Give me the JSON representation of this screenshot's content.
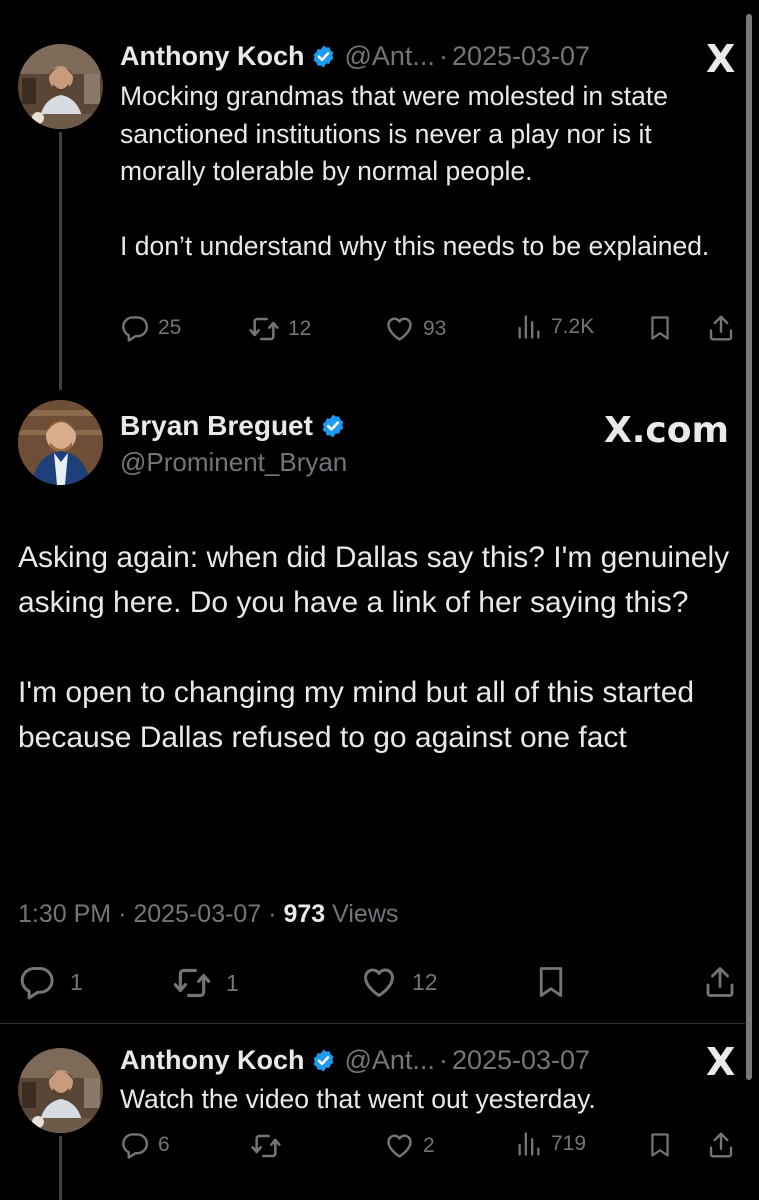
{
  "colors": {
    "background": "#000000",
    "text": "#e7e9ea",
    "muted": "#71767b",
    "verified": "#1d9bf0",
    "divider": "#2f3336"
  },
  "tweet1": {
    "name": "Anthony Koch",
    "handle": "@Ant...",
    "sep": "·",
    "date": "2025-03-07",
    "text": "Mocking grandmas that were molested in state sanctioned institutions is never a play nor is it morally tolerable by normal people.\n\nI don’t understand why this needs to be explained.",
    "reply_count": "25",
    "retweet_count": "12",
    "like_count": "93",
    "view_count": "7.2K",
    "logo": "X"
  },
  "main_tweet": {
    "name": "Bryan Breguet",
    "handle": "@Prominent_Bryan",
    "site": "X.com",
    "text": "Asking again: when did Dallas say this? I'm genuinely asking here. Do you have a link of her saying this?\n\nI'm open to changing my mind but all of this started because Dallas refused to go against one fact",
    "time": "1:30 PM",
    "sep": "·",
    "date": "2025-03-07",
    "views_count": "973",
    "views_label": "Views",
    "reply_count": "1",
    "retweet_count": "1",
    "like_count": "12"
  },
  "tweet2": {
    "name": "Anthony Koch",
    "handle": "@Ant...",
    "sep": "·",
    "date": "2025-03-07",
    "text": "Watch the video that went out yesterday.",
    "reply_count": "6",
    "like_count": "2",
    "view_count": "719",
    "logo": "X"
  },
  "icons": [
    "reply-icon",
    "retweet-icon",
    "like-icon",
    "views-icon",
    "bookmark-icon",
    "share-icon",
    "verified-badge-icon",
    "x-logo-icon"
  ]
}
